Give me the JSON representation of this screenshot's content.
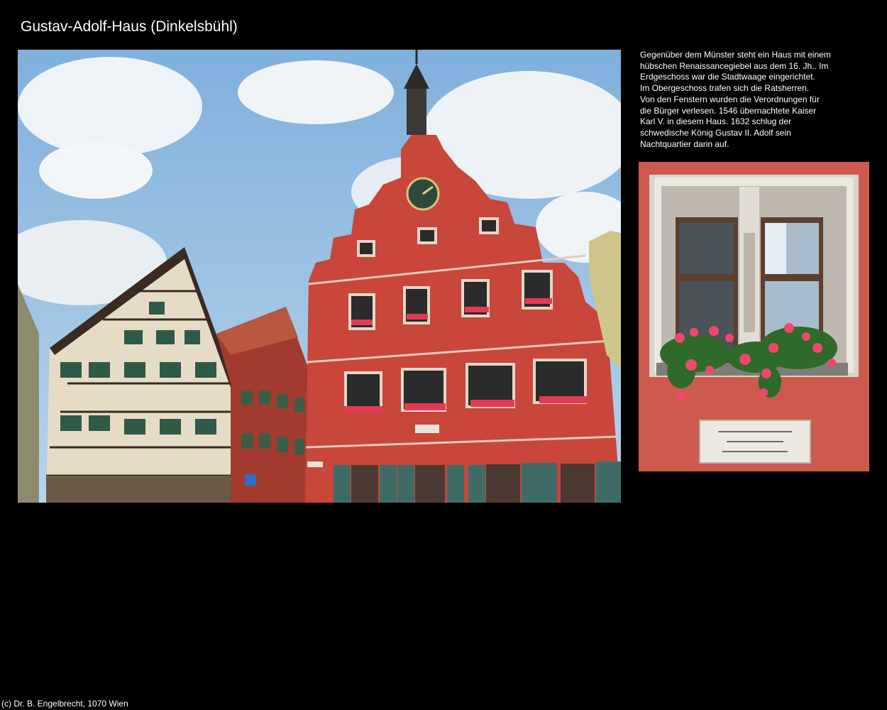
{
  "page": {
    "title": "Gustav-Adolf-Haus (Dinkelsbühl)",
    "copyright": "(c) Dr. B. Engelbrecht, 1070 Wien"
  },
  "description": {
    "lines": [
      "Gegenüber dem Münster steht ein Haus mit einem",
      "hübschen Renaissancegiebel aus dem 16. Jh.. Im",
      "Erdgeschoss war die Stadtwaage eingerichtet.",
      "Im Obergeschoss trafen sich die Ratsherren.",
      "Von den Fenstern wurden die Verordnungen für",
      "die Bürger verlesen. 1546 übernachtete Kaiser",
      "Karl V. in diesem Haus. 1632 schlug der",
      "schwedische König Gustav II. Adolf sein",
      "Nachtquartier darin auf."
    ]
  },
  "photos": {
    "main": {
      "icon": "photo-gable-house-street"
    },
    "detail": {
      "icon": "photo-window-plaque"
    }
  },
  "colors": {
    "background": "#000000",
    "text": "#ffffff",
    "facade_red": "#c8463a",
    "sky": "#9cc2e3"
  }
}
